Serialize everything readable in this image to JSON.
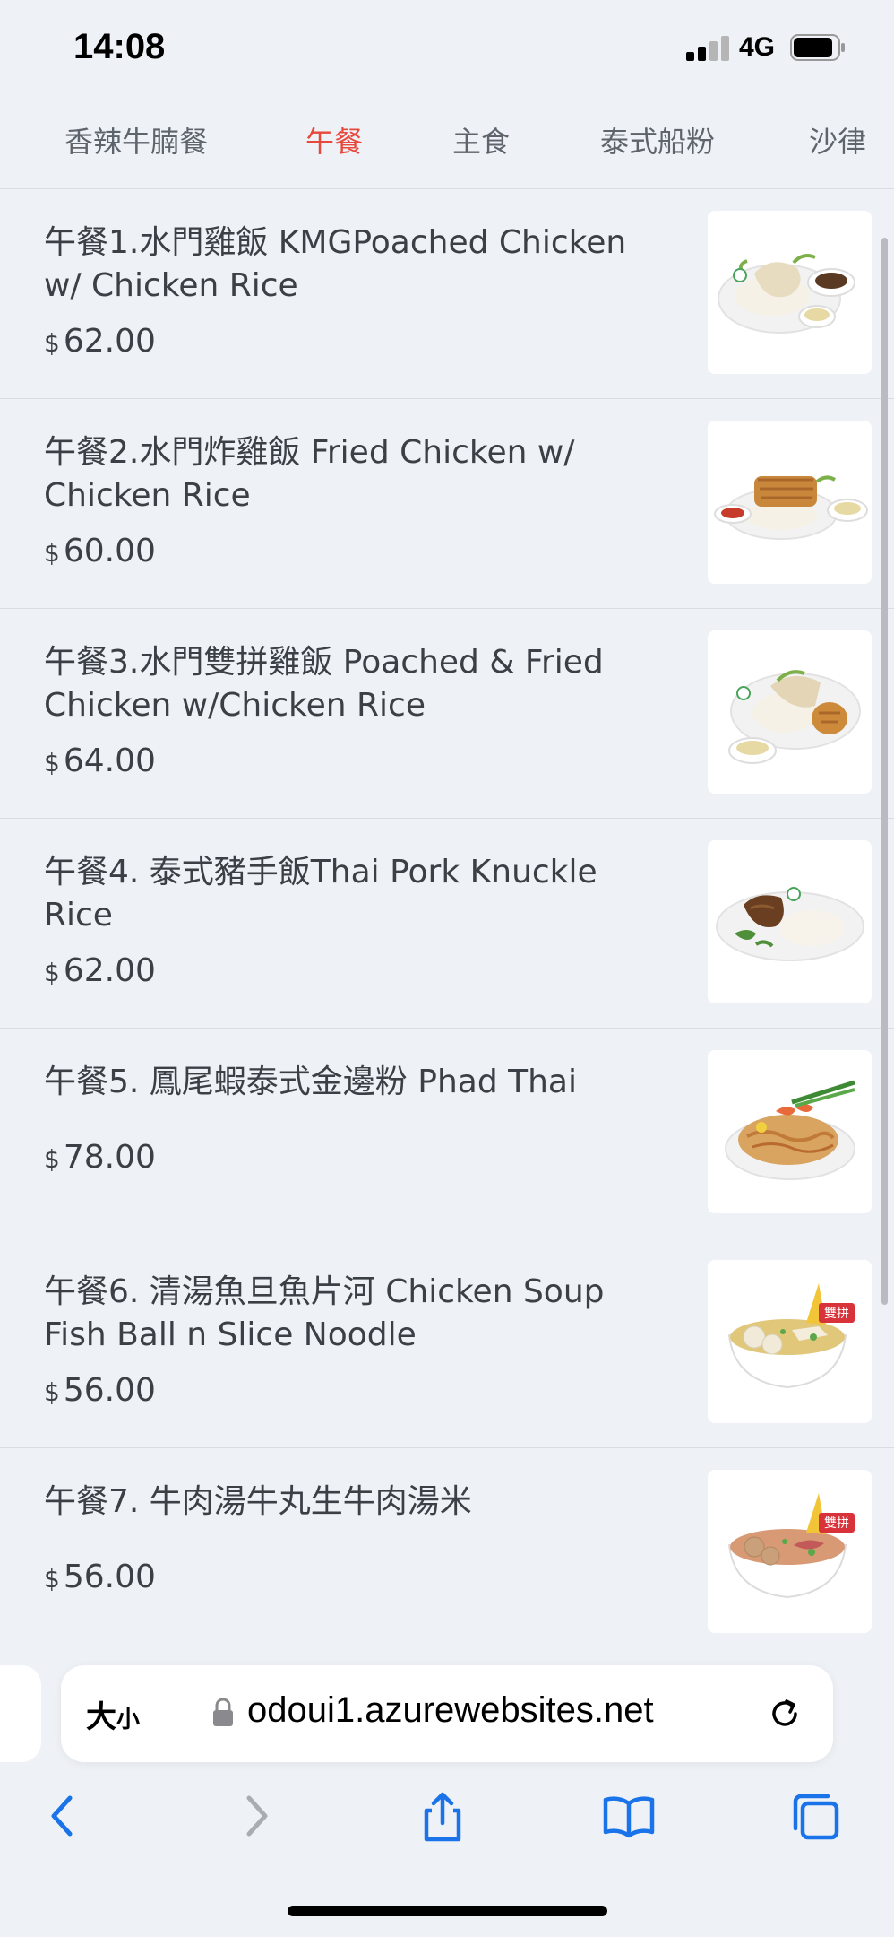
{
  "status_bar": {
    "time": "14:08",
    "network": "4G"
  },
  "tabs": [
    {
      "label": "香辣牛腩餐",
      "active": false
    },
    {
      "label": "午餐",
      "active": true
    },
    {
      "label": "主食",
      "active": false
    },
    {
      "label": "泰式船粉",
      "active": false
    },
    {
      "label": "沙律",
      "active": false
    }
  ],
  "menu": {
    "items": [
      {
        "name": "午餐1.水門雞飯 KMGPoached Chicken w/ Chicken Rice",
        "currency": "$",
        "price": "62.00"
      },
      {
        "name": "午餐2.水門炸雞飯 Fried Chicken w/ Chicken Rice",
        "currency": "$",
        "price": "60.00"
      },
      {
        "name": "午餐3.水門雙拼雞飯 Poached & Fried Chicken w/Chicken Rice",
        "currency": "$",
        "price": "64.00"
      },
      {
        "name": "午餐4. 泰式豬手飯Thai Pork Knuckle Rice",
        "currency": "$",
        "price": "62.00"
      },
      {
        "name": "午餐5. 鳳尾蝦泰式金邊粉 Phad Thai",
        "currency": "$",
        "price": "78.00"
      },
      {
        "name": "午餐6. 清湯魚旦魚片河 Chicken Soup Fish Ball n Slice Noodle",
        "currency": "$",
        "price": "56.00",
        "badge": "雙拼"
      },
      {
        "name": "午餐7. 牛肉湯牛丸生牛肉湯米",
        "currency": "$",
        "price": "56.00",
        "badge": "雙拼"
      }
    ]
  },
  "browser": {
    "text_size_label": "大",
    "text_size_small": "小",
    "url": "odoui1.azurewebsites.net"
  },
  "colors": {
    "accent": "#e8473c",
    "ios_blue": "#1a73e8",
    "background": "#eef1f5"
  },
  "icons": [
    "signal-icon",
    "battery-icon",
    "lock-icon",
    "reload-icon",
    "back-icon",
    "forward-icon",
    "share-icon",
    "bookmarks-icon",
    "tabs-icon"
  ]
}
